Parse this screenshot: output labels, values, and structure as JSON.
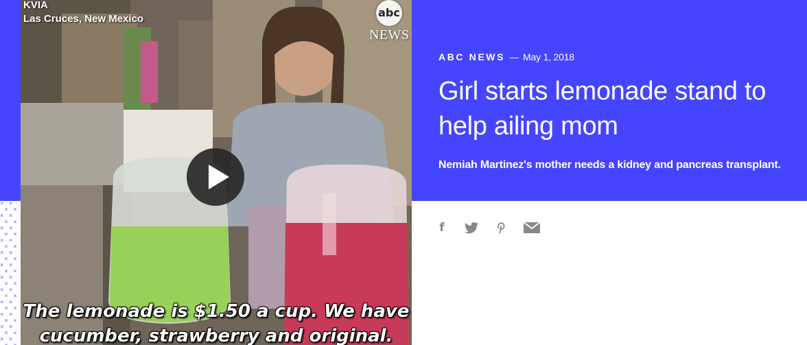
{
  "video": {
    "source_label": "KVIA",
    "location": "Las Cruces, New Mexico",
    "logo_text": "abc",
    "logo_news": "NEWS",
    "caption_line1": "The lemonade is $1.50 a cup. We have",
    "caption_line2": "cucumber, strawberry and original.",
    "play_icon": "play-icon"
  },
  "article": {
    "source": "ABC NEWS",
    "separator": "—",
    "date": "May 1, 2018",
    "headline": "Girl starts lemonade stand to help ailing mom",
    "subheadline": "Nemiah Martinez's mother needs a kidney and pancreas transplant."
  },
  "share": {
    "facebook_glyph": "f",
    "icons": [
      "facebook-icon",
      "twitter-icon",
      "pinterest-icon",
      "email-icon"
    ]
  },
  "colors": {
    "accent": "#4545ff",
    "icon_gray": "#888888",
    "text_on_accent": "#ffffff"
  }
}
